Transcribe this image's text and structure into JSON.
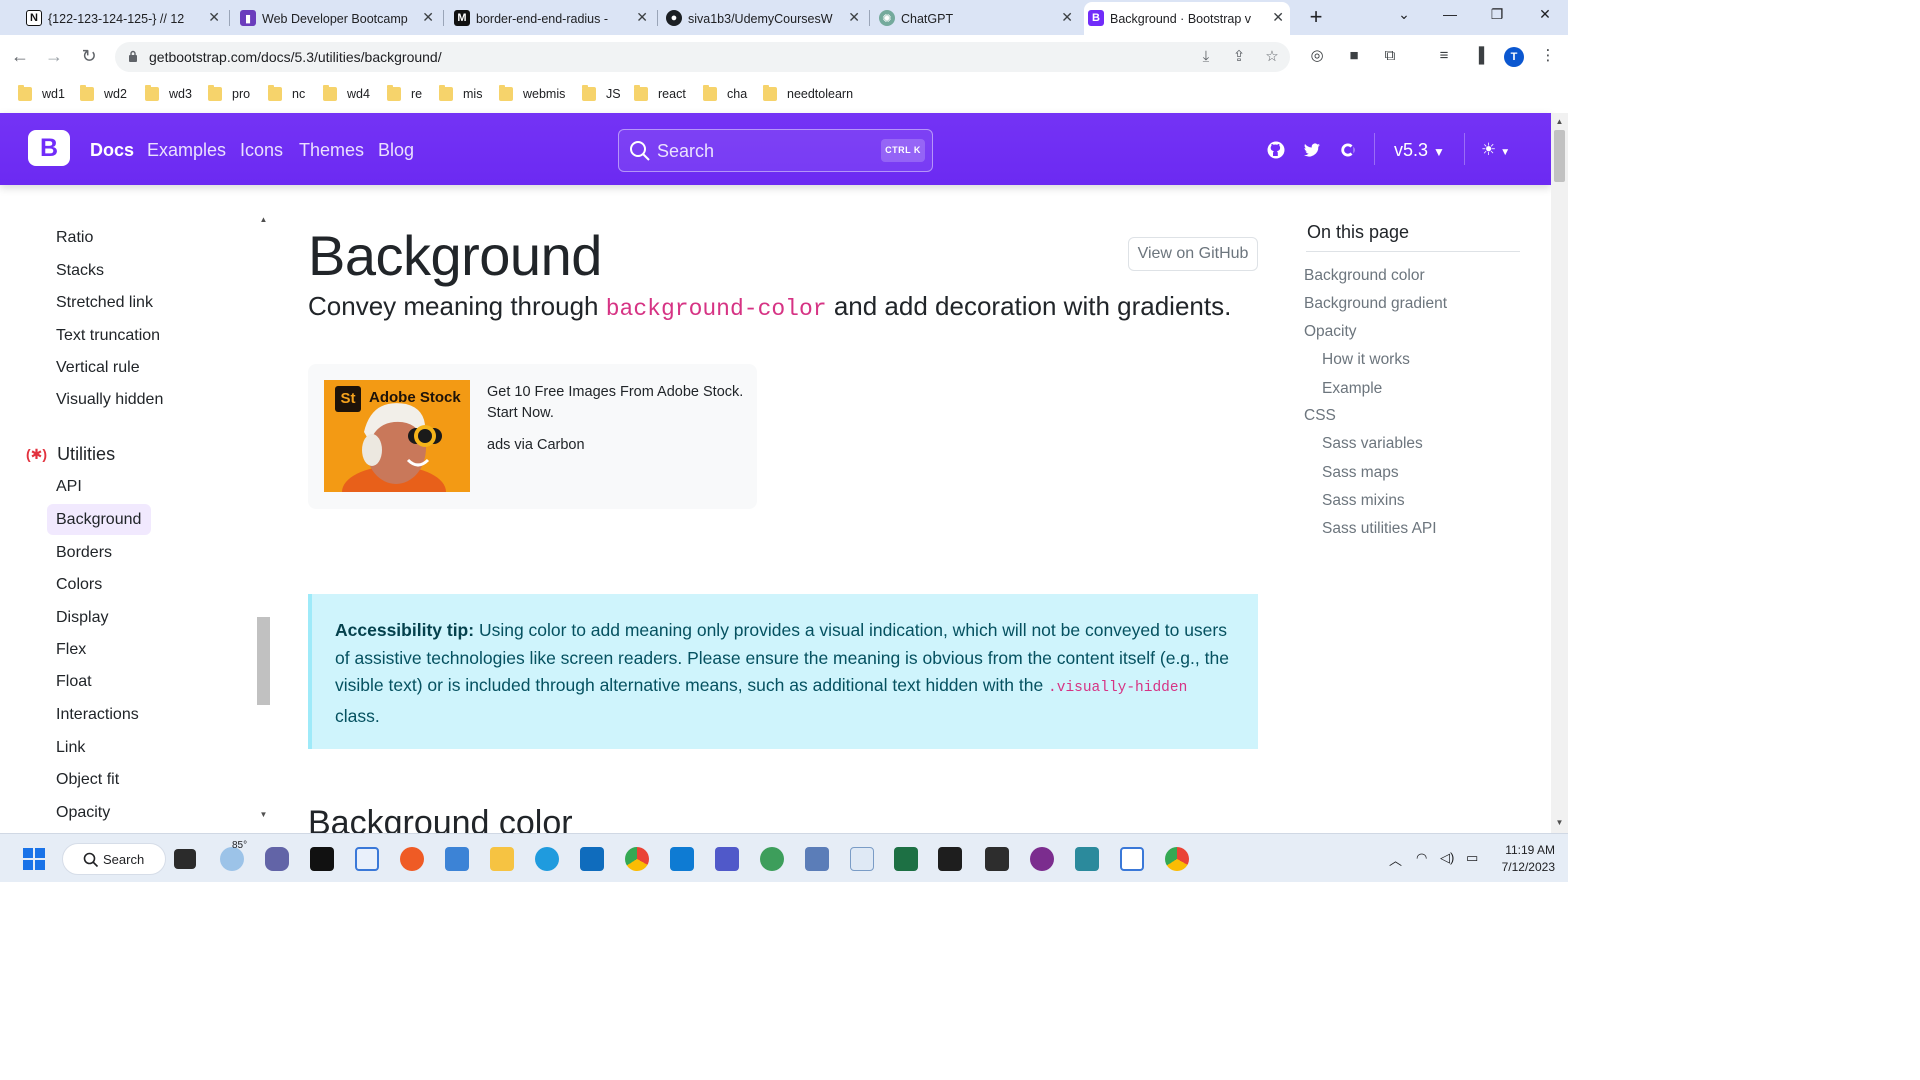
{
  "browser": {
    "tabs": [
      {
        "title": "{122-123-124-125-} // 12",
        "favicon": "notion-icon",
        "color": "#000000"
      },
      {
        "title": "Web Developer Bootcamp",
        "favicon": "trello-icon",
        "color": "#6a3cbc"
      },
      {
        "title": "border-end-end-radius - ",
        "favicon": "mdn-icon",
        "color": "#000000"
      },
      {
        "title": "siva1b3/UdemyCoursesW",
        "favicon": "github-icon",
        "color": "#1b1f23"
      },
      {
        "title": "ChatGPT",
        "favicon": "chatgpt-icon",
        "color": "#74aa9c"
      },
      {
        "title": "Background · Bootstrap v",
        "favicon": "bootstrap-icon",
        "color": "#712cf9",
        "active": true
      }
    ],
    "url": "getbootstrap.com/docs/5.3/utilities/background/",
    "profile_initial": "T",
    "bookmarks": [
      "wd1",
      "wd2",
      "wd3",
      "pro",
      "nc",
      "wd4",
      "re",
      "mis",
      "webmis",
      "JS",
      "react",
      "cha",
      "needtolearn"
    ]
  },
  "navbar": {
    "brand": "B",
    "links": [
      "Docs",
      "Examples",
      "Icons",
      "Themes",
      "Blog"
    ],
    "search_placeholder": "Search",
    "search_shortcut": "CTRL K",
    "version": "v5.3",
    "accent": "#712cf9"
  },
  "sidebar": {
    "items_top": [
      "Ratio",
      "Stacks",
      "Stretched link",
      "Text truncation",
      "Vertical rule",
      "Visually hidden"
    ],
    "section": "Utilities",
    "items": [
      "API",
      "Background",
      "Borders",
      "Colors",
      "Display",
      "Flex",
      "Float",
      "Interactions",
      "Link",
      "Object fit",
      "Opacity"
    ],
    "active_item": "Background"
  },
  "main": {
    "title": "Background",
    "github_button": "View on GitHub",
    "lead_before": "Convey meaning through ",
    "lead_code": "background-color",
    "lead_after": " and add decoration with gradients.",
    "ad": {
      "brand_badge": "St",
      "brand_name": "Adobe Stock",
      "text": "Get 10 Free Images From Adobe Stock. Start Now.",
      "via": "ads via Carbon"
    },
    "callout": {
      "label": "Accessibility tip:",
      "text_before": " Using color to add meaning only provides a visual indication, which will not be conveyed to users of assistive technologies like screen readers. Please ensure the meaning is obvious from the content itself (e.g., the visible text) or is included through alternative means, such as additional text hidden with the ",
      "code": ".visually-hidden",
      "text_after": " class."
    },
    "section_heading": "Background color"
  },
  "toc": {
    "title": "On this page",
    "items": [
      {
        "label": "Background color",
        "level": 1
      },
      {
        "label": "Background gradient",
        "level": 1
      },
      {
        "label": "Opacity",
        "level": 1
      },
      {
        "label": "How it works",
        "level": 2
      },
      {
        "label": "Example",
        "level": 2
      },
      {
        "label": "CSS",
        "level": 1
      },
      {
        "label": "Sass variables",
        "level": 2
      },
      {
        "label": "Sass maps",
        "level": 2
      },
      {
        "label": "Sass mixins",
        "level": 2
      },
      {
        "label": "Sass utilities API",
        "level": 2
      }
    ]
  },
  "taskbar": {
    "search_label": "Search",
    "weather": "85°",
    "time": "11:19 AM",
    "date": "7/12/2023"
  }
}
